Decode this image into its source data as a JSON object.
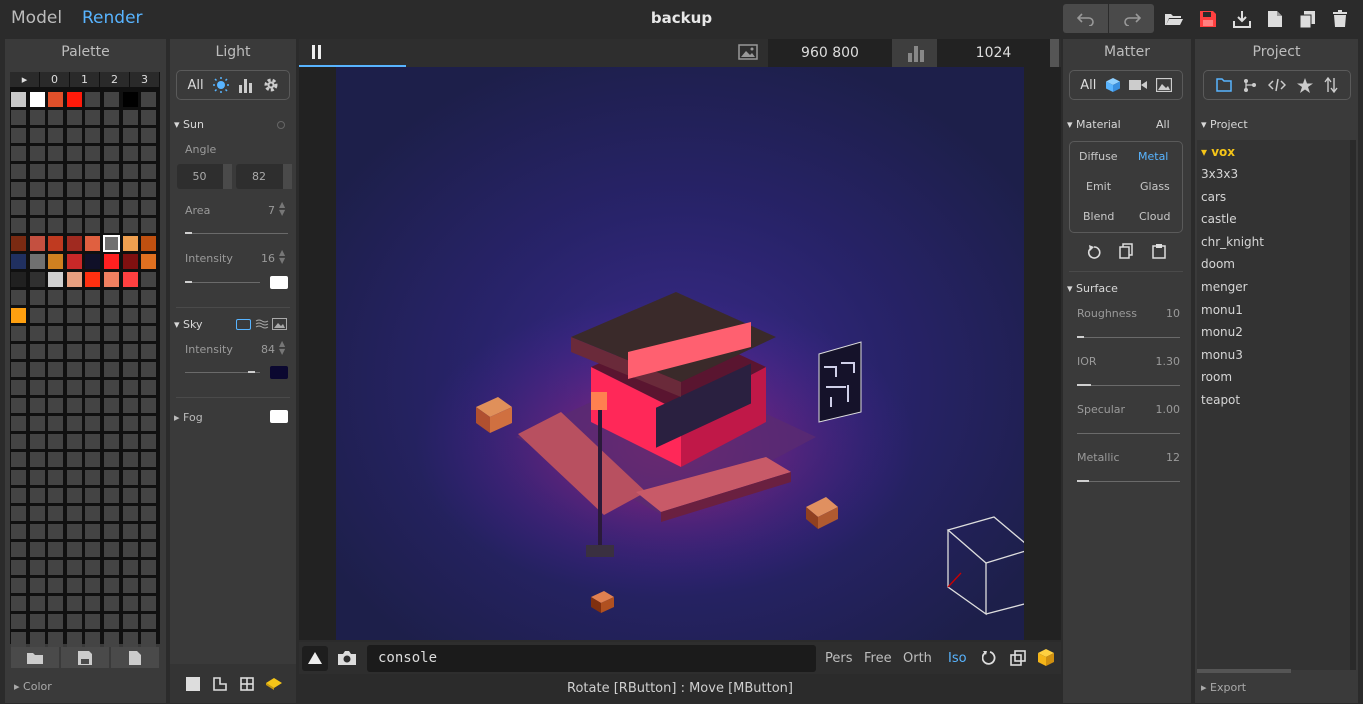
{
  "topbar": {
    "model": "Model",
    "render": "Render",
    "title": "backup"
  },
  "palette": {
    "header": "Palette",
    "cols": [
      "▸",
      "0",
      "1",
      "2",
      "3"
    ],
    "footer": "Color",
    "cells": [
      [
        0,
        0,
        "#c8c8c8"
      ],
      [
        1,
        0,
        "#ffffff"
      ],
      [
        2,
        0,
        "#e0502a"
      ],
      [
        3,
        0,
        "#ff1a0a"
      ],
      [
        6,
        0,
        "#000000"
      ],
      [
        0,
        8,
        "#7a2a12"
      ],
      [
        1,
        8,
        "#c45040"
      ],
      [
        2,
        8,
        "#c03a20"
      ],
      [
        3,
        8,
        "#a02a20"
      ],
      [
        4,
        8,
        "#e06040"
      ],
      [
        5,
        8,
        "#707070"
      ],
      [
        6,
        8,
        "#f0a050"
      ],
      [
        7,
        8,
        "#c05010"
      ],
      [
        0,
        9,
        "#203060"
      ],
      [
        1,
        9,
        "#707070"
      ],
      [
        2,
        9,
        "#d08020"
      ],
      [
        3,
        9,
        "#c82828"
      ],
      [
        4,
        9,
        "#101028"
      ],
      [
        5,
        9,
        "#ff2020"
      ],
      [
        6,
        9,
        "#801010"
      ],
      [
        7,
        9,
        "#e07020"
      ],
      [
        0,
        10,
        "#202020"
      ],
      [
        1,
        10,
        "#303030"
      ],
      [
        2,
        10,
        "#d0d0d0"
      ],
      [
        3,
        10,
        "#e8a080"
      ],
      [
        4,
        10,
        "#ff3010"
      ],
      [
        5,
        10,
        "#f08060"
      ],
      [
        6,
        10,
        "#ff4040"
      ],
      [
        0,
        12,
        "#ffa010"
      ]
    ]
  },
  "light": {
    "header": "Light",
    "all": "All",
    "sun": "Sun",
    "angle": "Angle",
    "angle1": "50",
    "angle2": "82",
    "area": "Area",
    "area_v": "7",
    "intensity": "Intensity",
    "intensity_v": "16",
    "sky": "Sky",
    "sky_intensity": "Intensity",
    "sky_intensity_v": "84",
    "fog": "Fog",
    "sky_color": "#0b0830"
  },
  "viewport": {
    "size": "960  800",
    "samples": "1024",
    "console": "console",
    "status": "Rotate [RButton] : Move [MButton]",
    "cams": [
      "Pers",
      "Free",
      "Orth",
      "Iso"
    ],
    "active_cam": "Iso",
    "progress": 0.14
  },
  "matter": {
    "header": "Matter",
    "all": "All",
    "material": "Material",
    "material_all": "All",
    "types": [
      "Diffuse",
      "Metal",
      "Emit",
      "Glass",
      "Blend",
      "Cloud"
    ],
    "active": "Metal",
    "surface": "Surface",
    "props": [
      [
        "Roughness",
        "10"
      ],
      [
        "IOR",
        "1.30"
      ],
      [
        "Specular",
        "1.00"
      ],
      [
        "Metallic",
        "12"
      ]
    ]
  },
  "project": {
    "header": "Project",
    "root": "Project",
    "folder": "vox",
    "items": [
      "3x3x3",
      "cars",
      "castle",
      "chr_knight",
      "doom",
      "menger",
      "monu1",
      "monu2",
      "monu3",
      "room",
      "teapot"
    ],
    "export": "Export"
  },
  "colors": {
    "accent": "#58b4ff",
    "save_red": "#ff4040",
    "folder_yellow": "#f5c518"
  }
}
